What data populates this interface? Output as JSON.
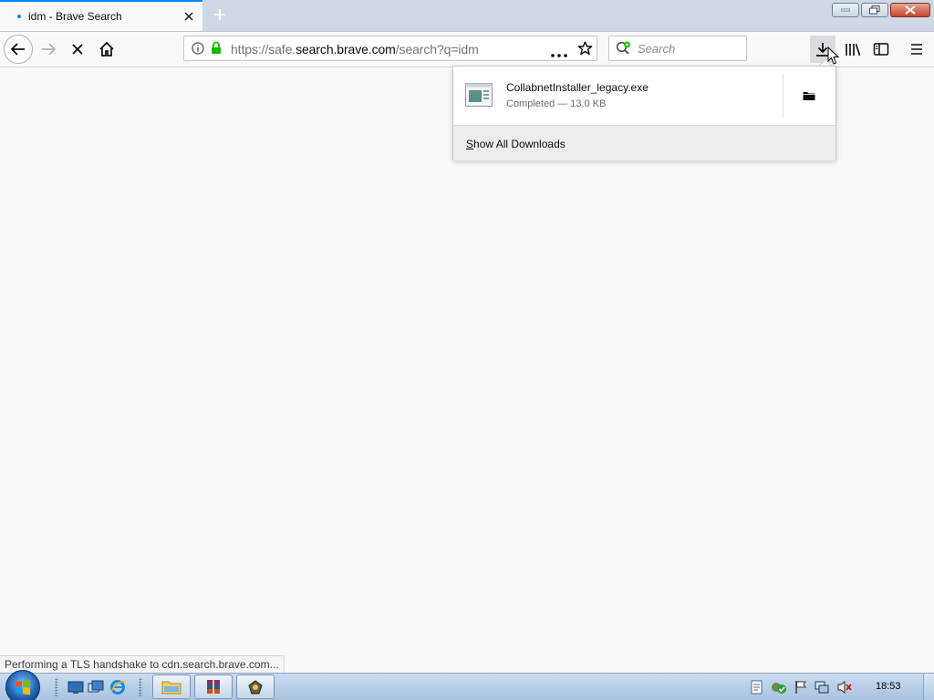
{
  "tab": {
    "title": "idm - Brave Search"
  },
  "navbar": {
    "url_prefix": "https://safe.",
    "url_host": "search.brave.com",
    "url_path": "/search?q=idm",
    "search_placeholder": "Search"
  },
  "downloads": {
    "items": [
      {
        "file_name": "CollabnetInstaller_legacy.exe",
        "status": "Completed — 13.0 KB"
      }
    ],
    "show_all_accesskey": "S",
    "show_all_rest": "how All Downloads"
  },
  "status": {
    "text": "Performing a TLS handshake to cdn.search.brave.com..."
  },
  "taskbar": {
    "clock": "18:53"
  },
  "colors": {
    "accent": "#0a84ff",
    "lock_green": "#12bc00"
  }
}
